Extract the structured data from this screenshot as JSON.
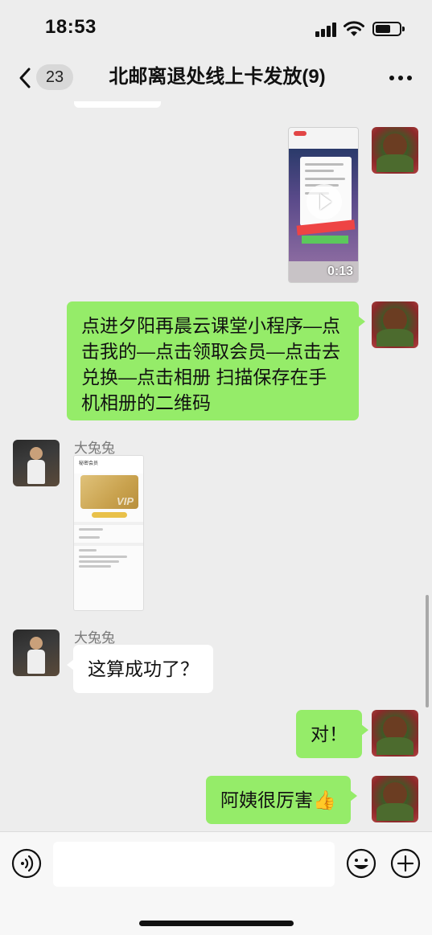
{
  "status_bar": {
    "time": "18:53"
  },
  "nav": {
    "unread_count": "23",
    "title": "北邮离退处线上卡发放(9)"
  },
  "messages": [
    {
      "type": "video",
      "direction": "outgoing",
      "duration": "0:13"
    },
    {
      "type": "text",
      "direction": "outgoing",
      "text": "点进夕阳再晨云课堂小程序—点击我的—点击领取会员—点击去兑换—点击相册 扫描保存在手机相册的二维码"
    },
    {
      "type": "image",
      "direction": "incoming",
      "sender": "大兔兔",
      "screen_title": "秘密会员",
      "card_text": "VIP"
    },
    {
      "type": "text",
      "direction": "incoming",
      "sender": "大兔兔",
      "text": "这算成功了？"
    },
    {
      "type": "text",
      "direction": "outgoing",
      "text": "对！"
    },
    {
      "type": "text",
      "direction": "outgoing",
      "text": "阿姨很厉害👍"
    }
  ],
  "input_bar": {
    "voice_icon": "voice-icon",
    "emoji_icon": "emoji-icon",
    "plus_icon": "plus-icon"
  },
  "colors": {
    "outgoing_bubble": "#95ec69",
    "incoming_bubble": "#ffffff",
    "background": "#ededed"
  }
}
